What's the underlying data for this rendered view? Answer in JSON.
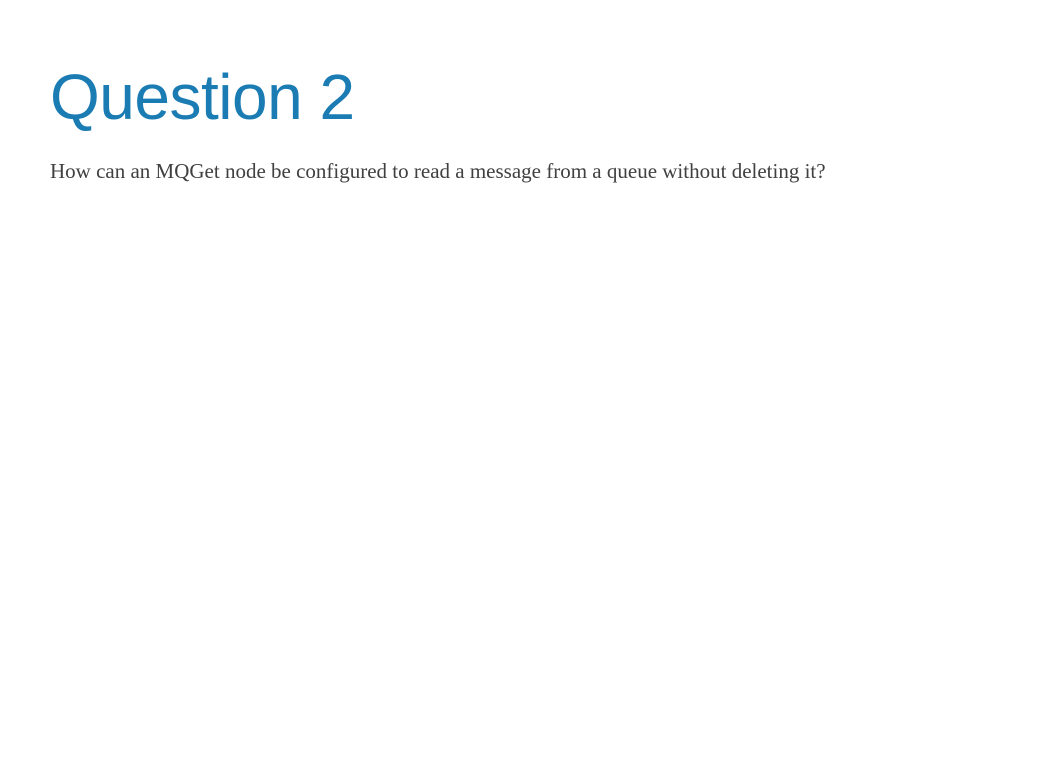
{
  "question": {
    "title": "Question 2",
    "body": "How can an MQGet node be configured to read a message from a queue without deleting it?"
  }
}
